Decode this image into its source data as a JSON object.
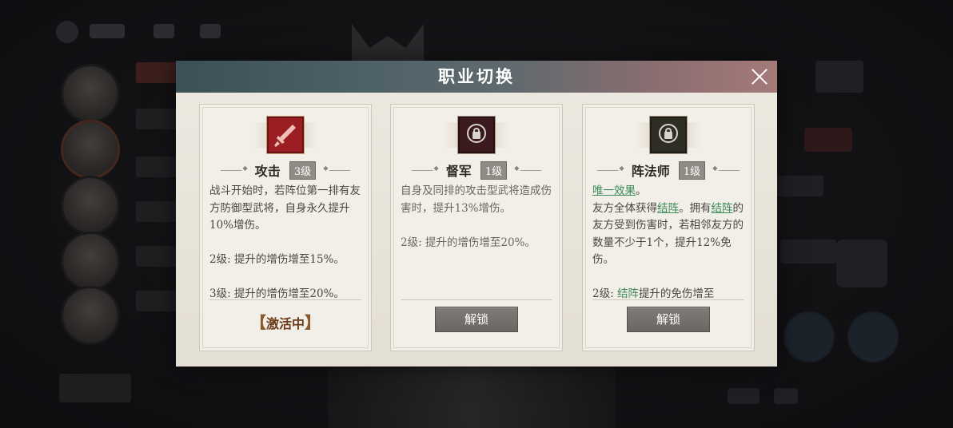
{
  "dialog": {
    "title": "职业切换"
  },
  "cards": [
    {
      "name": "攻击",
      "level": "3级",
      "icon": "sword-icon",
      "desc": [
        "战斗开始时，若阵位第一排有友方防御型武将，自身永久提升10%增伤。",
        "2级: 提升的增伤增至15%。",
        "3级: 提升的增伤增至20%。"
      ],
      "status": "激活中"
    },
    {
      "name": "督军",
      "level": "1级",
      "icon": "lock-icon",
      "desc": [
        "自身及同排的攻击型武将造成伤害时，提升13%增伤。",
        "2级: 提升的增伤增至20%。"
      ],
      "button": "解锁"
    },
    {
      "name": "阵法师",
      "level": "1级",
      "icon": "lock-icon",
      "desc_parts": {
        "unique": "唯一效果",
        "p1": "。",
        "p2_a": "友方全体获得",
        "link1": "结阵",
        "p2_b": "。拥有",
        "link2": "结阵",
        "p2_c": "的友方受到伤害时，若相邻友方的数量不少于1个，提升12%免伤。",
        "p3_a": "2级: ",
        "link3": "结阵",
        "p3_b": "提升的免伤增至"
      },
      "button": "解锁"
    }
  ],
  "colors": {
    "link_green": "#3a8a58",
    "attack_red": "#9b1f22",
    "header_left": "#3c5058",
    "header_right": "#a47a78"
  }
}
